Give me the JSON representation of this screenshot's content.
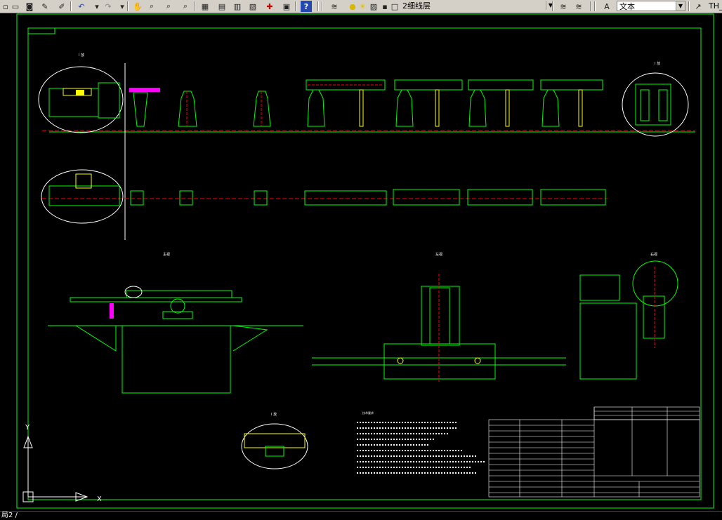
{
  "toolbar": {
    "layer_combo_value": "2细线层",
    "text_style_value": "文本",
    "right_edge_label": "TH_"
  },
  "status": {
    "command_text": "局2 /"
  },
  "drawing": {
    "colors": {
      "frame": "#00ff00",
      "geometry": "#00ff00",
      "centerline": "#ff0000",
      "annotation": "#ffffff",
      "part_magenta": "#ff00ff",
      "yellow_part": "#ffff00",
      "cyan_dims": "#00ffff"
    }
  }
}
